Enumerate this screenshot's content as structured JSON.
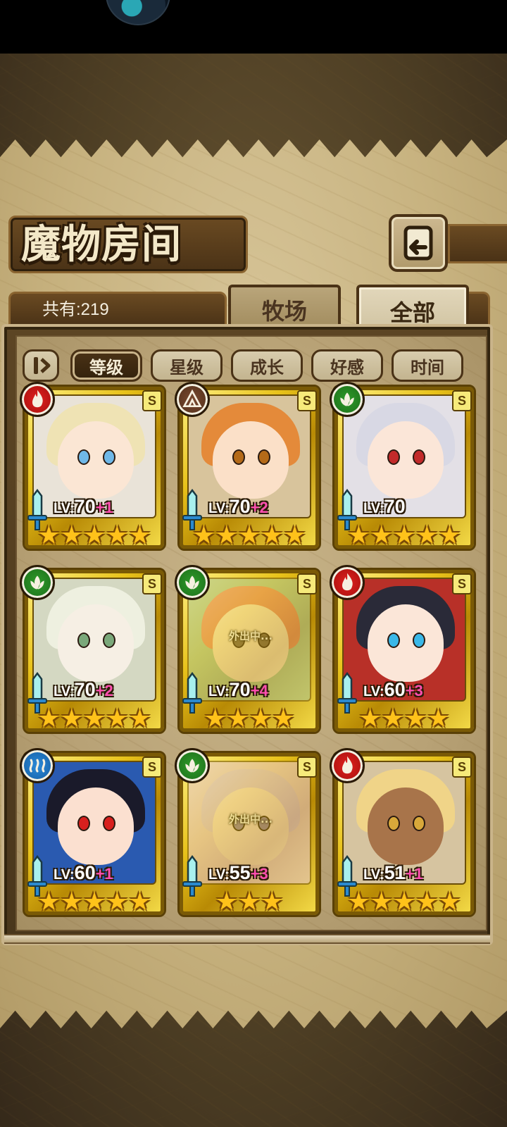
{
  "page": {
    "title": "魔物房间",
    "count_label": "共有:219",
    "tabs": [
      {
        "label": "牧场"
      },
      {
        "label": "全部"
      }
    ],
    "sort_buttons": [
      {
        "label": "等级"
      },
      {
        "label": "星级"
      },
      {
        "label": "成长"
      },
      {
        "label": "好感"
      },
      {
        "label": "时间"
      }
    ],
    "active_sort": "等级",
    "active_tab": "全部"
  },
  "colors": {
    "fire": "#d01a18",
    "earth": "#6a3e26",
    "wood": "#2a8a26",
    "water": "#1f78c8",
    "plus": "#ff4fb0",
    "gold": "#e8c21a"
  },
  "monsters": [
    {
      "element": "fire",
      "rank": "S",
      "level": "70",
      "bonus": "+1",
      "stars": 5,
      "away": false,
      "away_text": "",
      "hair": "#efe3b4",
      "skin": "#fbe6d4",
      "eye": "#6fb8e8",
      "bg": "#e9e3d8"
    },
    {
      "element": "earth",
      "rank": "S",
      "level": "70",
      "bonus": "+2",
      "stars": 5,
      "away": false,
      "away_text": "",
      "hair": "#e48a3a",
      "skin": "#fbe0c8",
      "eye": "#b46a18",
      "bg": "#d8c49c"
    },
    {
      "element": "wood",
      "rank": "S",
      "level": "70",
      "bonus": "",
      "stars": 5,
      "away": false,
      "away_text": "",
      "hair": "#d8d8e4",
      "skin": "#fbe6d8",
      "eye": "#c22a2a",
      "bg": "#e3e0e6"
    },
    {
      "element": "wood",
      "rank": "S",
      "level": "70",
      "bonus": "+2",
      "stars": 5,
      "away": false,
      "away_text": "",
      "hair": "#eef0e0",
      "skin": "#f6efe4",
      "eye": "#7aa87a",
      "bg": "#d4d8c2"
    },
    {
      "element": "wood",
      "rank": "S",
      "level": "70",
      "bonus": "+4",
      "stars": 4,
      "away": true,
      "away_text": "外出中...",
      "hair": "#e88a6a",
      "skin": "#f8e6c8",
      "eye": "#6a5a4a",
      "bg": "#a8c89a"
    },
    {
      "element": "fire",
      "rank": "S",
      "level": "60",
      "bonus": "+3",
      "stars": 4,
      "away": false,
      "away_text": "",
      "hair": "#2a2a38",
      "skin": "#fbe6d8",
      "eye": "#3ab8e8",
      "bg": "#b83028"
    },
    {
      "element": "water",
      "rank": "S",
      "level": "60",
      "bonus": "+1",
      "stars": 5,
      "away": false,
      "away_text": "",
      "hair": "#1a1a2a",
      "skin": "#fbe0d0",
      "eye": "#d8201e",
      "bg": "#2a5ab0"
    },
    {
      "element": "wood",
      "rank": "S",
      "level": "55",
      "bonus": "+3",
      "stars": 3,
      "away": true,
      "away_text": "外出中...",
      "hair": "#d8c0e8",
      "skin": "#f4dcd8",
      "eye": "#8a7aa8",
      "bg": "#e6c8d8"
    },
    {
      "element": "fire",
      "rank": "S",
      "level": "51",
      "bonus": "+1",
      "stars": 5,
      "away": false,
      "away_text": "",
      "hair": "#f0d488",
      "skin": "#a8744a",
      "eye": "#d8a83a",
      "bg": "#d6c4a0"
    }
  ],
  "level_prefix": "LV:"
}
